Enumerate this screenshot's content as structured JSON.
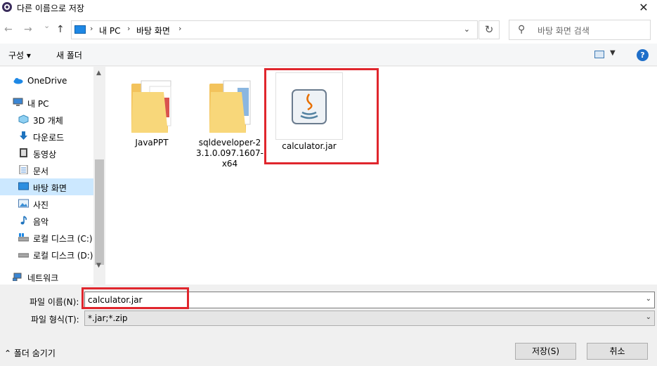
{
  "window": {
    "title": "다른 이름으로 저장",
    "close_glyph": "✕"
  },
  "nav": {
    "back_glyph": "←",
    "forward_glyph": "→",
    "recent_glyph": "⌄",
    "up_glyph": "↑",
    "breadcrumb": [
      "내 PC",
      "바탕 화면"
    ],
    "sep_glyph": "›",
    "refresh_glyph": "↻",
    "search_placeholder": "바탕 화면 검색",
    "search_glyph": "⚲"
  },
  "toolbar": {
    "organize": "구성 ▾",
    "new_folder": "새 폴더",
    "help": "?",
    "view_dropdown": "▼"
  },
  "sidebar": {
    "items": [
      {
        "label": "OneDrive",
        "icon": "cloud-icon"
      },
      {
        "label": "내 PC",
        "icon": "pc-icon"
      },
      {
        "label": "3D 개체",
        "icon": "cube-icon"
      },
      {
        "label": "다운로드",
        "icon": "download-icon"
      },
      {
        "label": "동영상",
        "icon": "video-icon"
      },
      {
        "label": "문서",
        "icon": "document-icon"
      },
      {
        "label": "바탕 화면",
        "icon": "desktop-icon",
        "selected": true
      },
      {
        "label": "사진",
        "icon": "pictures-icon"
      },
      {
        "label": "음악",
        "icon": "music-icon"
      },
      {
        "label": "로컬 디스크 (C:)",
        "icon": "drive-c-icon"
      },
      {
        "label": "로컬 디스크 (D:)",
        "icon": "drive-d-icon"
      },
      {
        "label": "네트워크",
        "icon": "network-icon"
      }
    ],
    "scroll_up": "▲",
    "scroll_down": "▼"
  },
  "files": [
    {
      "label": "JavaPPT",
      "type": "folder"
    },
    {
      "label": "sqldeveloper-23.1.0.097.1607-x64",
      "type": "folder"
    },
    {
      "label": "calculator.jar",
      "type": "jar"
    }
  ],
  "form": {
    "filename_label": "파일 이름(N):",
    "filename_value": "calculator.jar",
    "filetype_label": "파일 형식(T):",
    "filetype_value": "*.jar;*.zip",
    "dropdown_glyph": "⌄"
  },
  "footer": {
    "hide_folders": "⌃  폴더 숨기기",
    "save": "저장(S)",
    "cancel": "취소"
  },
  "colors": {
    "highlight": "#e0262d",
    "selected": "#cce8ff",
    "accent": "#1f6fc9"
  }
}
